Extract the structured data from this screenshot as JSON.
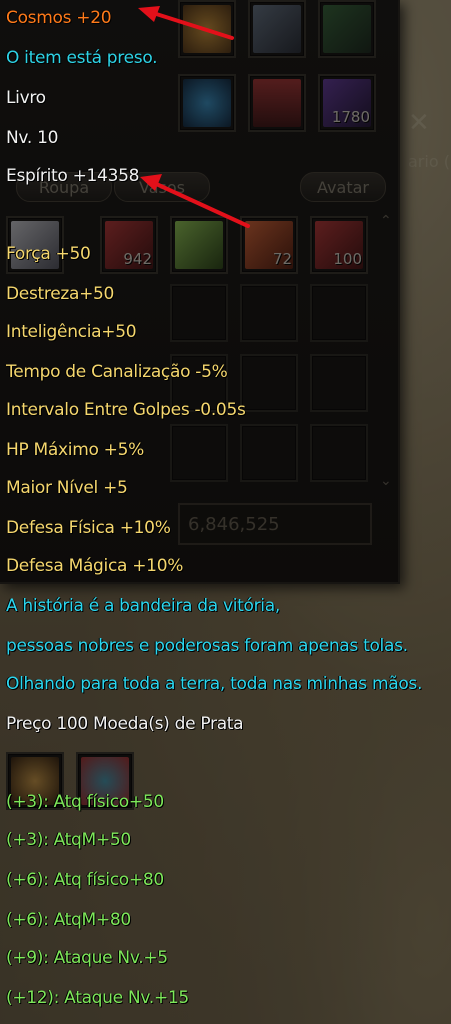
{
  "item": {
    "cosmos": "Cosmos +20",
    "locked": "O item está preso.",
    "name": "Livro",
    "level": "Nv. 10",
    "spirit": "Espírito +14358",
    "stats": [
      "Força +50",
      "Destreza+50",
      "Inteligência+50",
      "Tempo de Canalização -5%",
      "Intervalo Entre Golpes -0.05s",
      "HP Máximo +5%",
      "Maior Nível +5",
      "Defesa Física +10%",
      "Defesa Mágica +10%"
    ],
    "lore": [
      "A história é a bandeira da vitória,",
      "pessoas nobres e poderosas foram apenas tolas.",
      "Olhando para toda a terra, toda nas minhas mãos."
    ],
    "price": "Preço 100 Moeda(s) de Prata",
    "refines": [
      "(+3): Atq físico+50",
      "(+3): AtqM+50",
      "(+6): Atq físico+80",
      "(+6): AtqM+80",
      "(+9): Ataque Nv.+5",
      "(+12): Ataque Nv.+15"
    ]
  },
  "panel": {
    "tab_clothes": "Roupa",
    "tab_vases": "Vasos",
    "tab_avatar": "Avatar",
    "money": "6,846,525",
    "side_text": "ario (",
    "slot_counts": [
      "1780",
      "942",
      "72",
      "100"
    ]
  },
  "colors": {
    "orange": "#ff7a1a",
    "cyan": "#2ed3e6",
    "gold": "#f5d76e",
    "green": "#7ee85a",
    "arrow": "#e3101a"
  }
}
